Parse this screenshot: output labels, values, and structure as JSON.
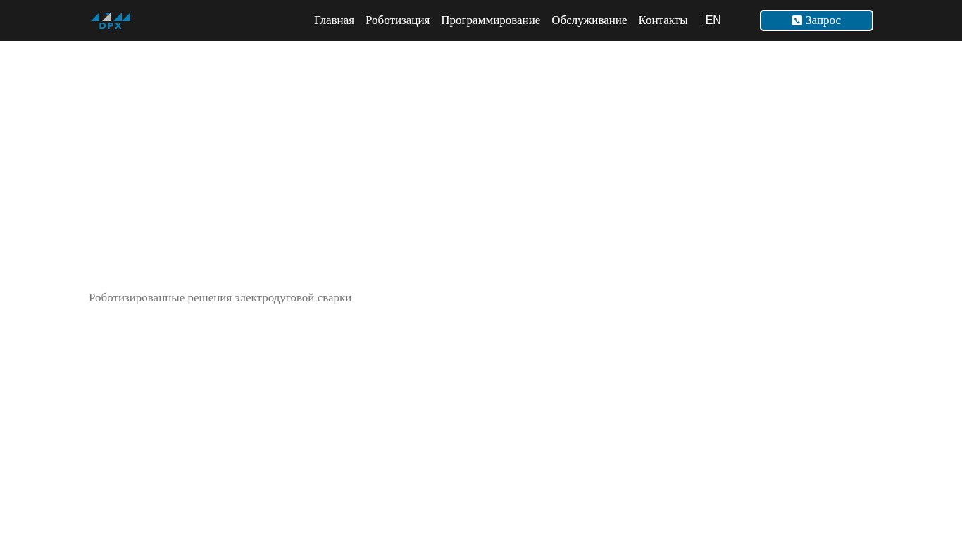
{
  "logo": {
    "text": "DPX"
  },
  "nav": [
    {
      "label": "Главная"
    },
    {
      "label": "Роботизация"
    },
    {
      "label": "Программирование"
    },
    {
      "label": "Обслуживание"
    },
    {
      "label": "Контакты"
    }
  ],
  "language": "EN",
  "request_button": {
    "label": "Запрос"
  },
  "caption": "Роботизированные решения электродуговой сварки"
}
